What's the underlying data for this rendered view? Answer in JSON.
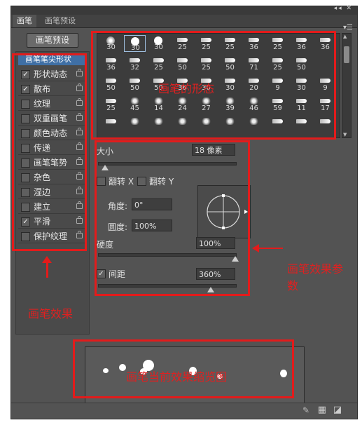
{
  "window": {
    "controls": "◂◂ ✕"
  },
  "tabs": [
    {
      "label": "画笔"
    },
    {
      "label": "画笔预设"
    }
  ],
  "panel_menu_icon": "panel-menu-icon",
  "preset_button": "画笔预设",
  "left_panel": {
    "header": "画笔笔尖形状",
    "options": [
      {
        "label": "形状动态",
        "checked": true
      },
      {
        "label": "散布",
        "checked": true
      },
      {
        "label": "纹理",
        "checked": false
      },
      {
        "label": "双重画笔",
        "checked": false
      },
      {
        "label": "颜色动态",
        "checked": false
      },
      {
        "label": "传递",
        "checked": false
      },
      {
        "label": "画笔笔势",
        "checked": false
      },
      {
        "label": "杂色",
        "checked": false
      },
      {
        "label": "湿边",
        "checked": false
      },
      {
        "label": "建立",
        "checked": false
      },
      {
        "label": "平滑",
        "checked": true
      },
      {
        "label": "保护纹理",
        "checked": false
      }
    ]
  },
  "brush_grid": {
    "rows": [
      [
        "30",
        "30",
        "30",
        "25",
        "25",
        "25",
        "36",
        "25",
        "36",
        "36"
      ],
      [
        "36",
        "32",
        "25",
        "50",
        "25",
        "50",
        "71",
        "25",
        "50"
      ],
      [
        "50",
        "50",
        "50",
        "36",
        "30",
        "30",
        "20",
        "9",
        "30",
        "9"
      ],
      [
        "25",
        "45",
        "14",
        "24",
        "27",
        "39",
        "46",
        "59",
        "11",
        "17"
      ],
      [
        "",
        "",
        "",
        "",
        "",
        "",
        "",
        "",
        "",
        ""
      ]
    ]
  },
  "size": {
    "label": "大小",
    "value": "18 像素",
    "slider": 0.05
  },
  "flip": {
    "x_label": "翻转 X",
    "y_label": "翻转 Y"
  },
  "angle": {
    "label": "角度:",
    "value": "0°"
  },
  "roundness": {
    "label": "圆度:",
    "value": "100%"
  },
  "hardness": {
    "label": "硬度",
    "value": "100%",
    "slider": 1.0
  },
  "spacing": {
    "label": "间距",
    "value": "360%",
    "checked": true,
    "slider": 0.82
  },
  "annotations": {
    "brush_shape": "画笔的形态",
    "brush_effect": "画笔效果",
    "brush_params": "画笔效果参数",
    "preview": "画笔当前效果缩览图"
  },
  "colors": {
    "annotation": "#e31b1b",
    "selected_header": "#3f6fa5"
  }
}
